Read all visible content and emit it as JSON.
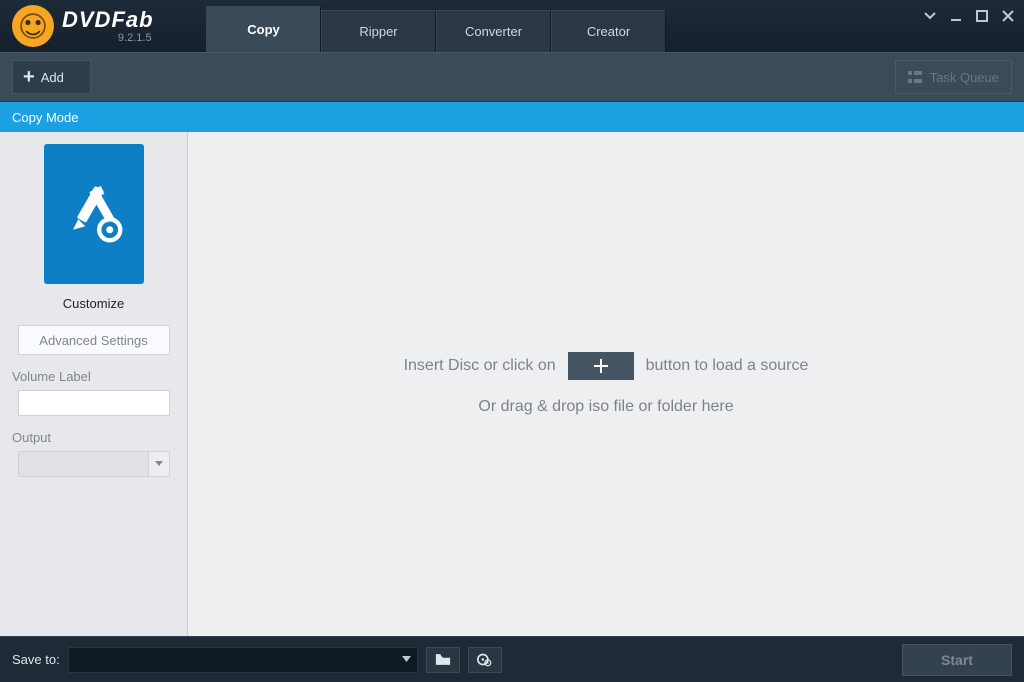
{
  "app": {
    "brand": "DVDFab",
    "version": "9.2.1.5"
  },
  "tabs": [
    {
      "label": "Copy",
      "active": true
    },
    {
      "label": "Ripper",
      "active": false
    },
    {
      "label": "Converter",
      "active": false
    },
    {
      "label": "Creator",
      "active": false
    }
  ],
  "toolbar": {
    "add_label": "Add",
    "task_queue_label": "Task Queue"
  },
  "modebar": {
    "title": "Copy Mode"
  },
  "sidebar": {
    "mode_caption": "Customize",
    "advanced_label": "Advanced Settings",
    "volume_label": "Volume Label",
    "volume_value": "",
    "output_label": "Output",
    "output_value": ""
  },
  "main": {
    "hint_before": "Insert Disc or click on",
    "hint_after": "button to load a source",
    "hint_line2": "Or drag & drop iso file or folder here"
  },
  "footer": {
    "save_to_label": "Save to:",
    "save_to_value": "",
    "start_label": "Start"
  }
}
